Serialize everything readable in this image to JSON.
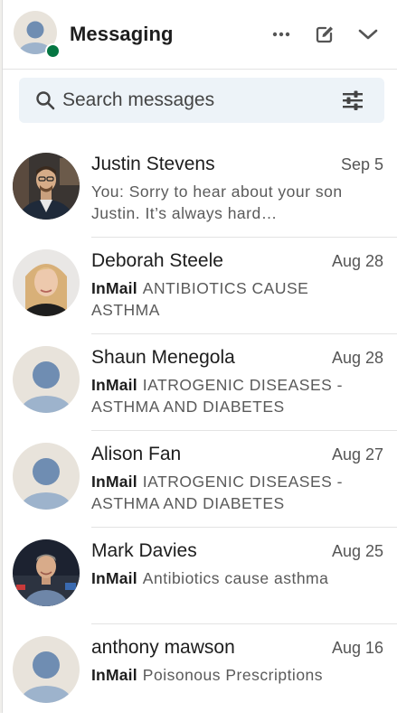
{
  "header": {
    "title": "Messaging",
    "more_icon": "more-icon",
    "compose_icon": "compose-icon",
    "collapse_icon": "chevron-down-icon",
    "presence_color": "#057642"
  },
  "search": {
    "placeholder": "Search messages",
    "background": "#edf3f8"
  },
  "conversations": [
    {
      "name": "Justin Stevens",
      "date": "Sep 5",
      "prefix": "",
      "snippet": "You: Sorry to hear about your son Justin. It’s always hard…",
      "avatar": "photo"
    },
    {
      "name": "Deborah Steele",
      "date": "Aug 28",
      "prefix": "InMail",
      "snippet": "ANTIBIOTICS CAUSE ASTHMA",
      "avatar": "photo"
    },
    {
      "name": "Shaun Menegola",
      "date": "Aug 28",
      "prefix": "InMail",
      "snippet": "IATROGENIC DISEASES - ASTHMA AND DIABETES",
      "avatar": "placeholder"
    },
    {
      "name": "Alison Fan",
      "date": "Aug 27",
      "prefix": "InMail",
      "snippet": "IATROGENIC DISEASES - ASTHMA AND DIABETES",
      "avatar": "placeholder"
    },
    {
      "name": "Mark Davies",
      "date": "Aug 25",
      "prefix": "InMail",
      "snippet": "Antibiotics cause asthma",
      "avatar": "photo"
    },
    {
      "name": "anthony mawson",
      "date": "Aug 16",
      "prefix": "InMail",
      "snippet": "Poisonous Prescriptions",
      "avatar": "placeholder"
    }
  ]
}
